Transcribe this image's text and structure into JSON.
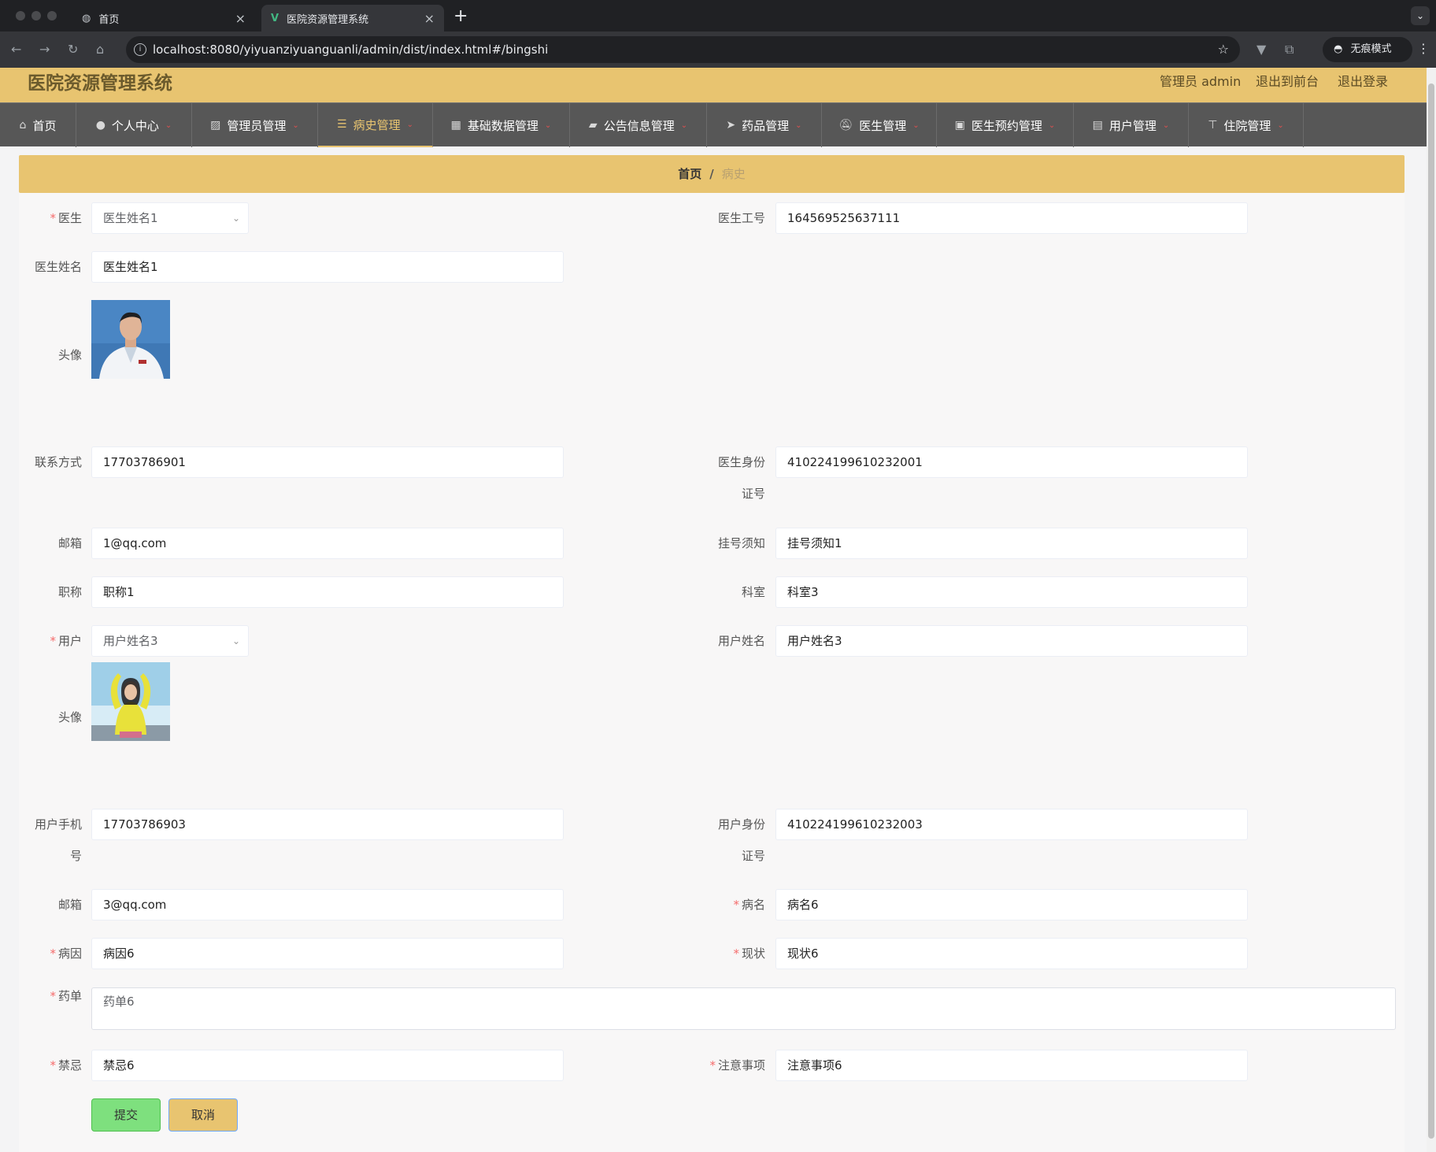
{
  "browser": {
    "tabs": [
      {
        "title": "首页",
        "active": false
      },
      {
        "title": "医院资源管理系统",
        "active": true
      }
    ],
    "url": "localhost:8080/yiyuanziyuanguanli/admin/dist/index.html#/bingshi",
    "incognito_label": "无痕模式"
  },
  "header": {
    "title": "医院资源管理系统",
    "user_label": "管理员 admin",
    "to_front": "退出到前台",
    "logout": "退出登录"
  },
  "nav": [
    {
      "label": "首页",
      "icon": "home-icon",
      "has_dropdown": false
    },
    {
      "label": "个人中心",
      "icon": "user-icon",
      "has_dropdown": true
    },
    {
      "label": "管理员管理",
      "icon": "chart-icon",
      "has_dropdown": true
    },
    {
      "label": "病史管理",
      "icon": "list-icon",
      "has_dropdown": true,
      "active": true
    },
    {
      "label": "基础数据管理",
      "icon": "grid-icon",
      "has_dropdown": true
    },
    {
      "label": "公告信息管理",
      "icon": "ticket-icon",
      "has_dropdown": true
    },
    {
      "label": "药品管理",
      "icon": "send-icon",
      "has_dropdown": true
    },
    {
      "label": "医生管理",
      "icon": "bell-off-icon",
      "has_dropdown": true
    },
    {
      "label": "医生预约管理",
      "icon": "briefcase-icon",
      "has_dropdown": true
    },
    {
      "label": "用户管理",
      "icon": "clipboard-icon",
      "has_dropdown": true
    },
    {
      "label": "住院管理",
      "icon": "stamp-icon",
      "has_dropdown": true
    }
  ],
  "breadcrumb": {
    "home": "首页",
    "separator": "/",
    "current": "病史"
  },
  "form": {
    "doctor": {
      "label": "医生",
      "value": "医生姓名1"
    },
    "doctor_no": {
      "label": "医生工号",
      "value": "164569525637111"
    },
    "doctor_name": {
      "label": "医生姓名",
      "value": "医生姓名1"
    },
    "doctor_avatar": {
      "label": "头像"
    },
    "doctor_phone": {
      "label": "联系方式",
      "value": "17703786901"
    },
    "doctor_idcard": {
      "label_1": "医生身份",
      "label_2": "证号",
      "value": "410224199610232001"
    },
    "doctor_email": {
      "label": "邮箱",
      "value": "1@qq.com"
    },
    "register_notice": {
      "label": "挂号须知",
      "value": "挂号须知1"
    },
    "title": {
      "label": "职称",
      "value": "职称1"
    },
    "department": {
      "label": "科室",
      "value": "科室3"
    },
    "user": {
      "label": "用户",
      "value": "用户姓名3"
    },
    "user_name": {
      "label": "用户姓名",
      "value": "用户姓名3"
    },
    "user_avatar": {
      "label": "头像"
    },
    "user_phone": {
      "label_1": "用户手机",
      "label_2": "号",
      "value": "17703786903"
    },
    "user_idcard": {
      "label_1": "用户身份",
      "label_2": "证号",
      "value": "410224199610232003"
    },
    "user_email": {
      "label": "邮箱",
      "value": "3@qq.com"
    },
    "disease": {
      "label": "病名",
      "value": "病名6"
    },
    "cause": {
      "label": "病因",
      "value": "病因6"
    },
    "status": {
      "label": "现状",
      "value": "现状6"
    },
    "prescription": {
      "label": "药单",
      "value": "药单6"
    },
    "taboo": {
      "label": "禁忌",
      "value": "禁忌6"
    },
    "notes": {
      "label": "注意事项",
      "value": "注意事项6"
    },
    "submit": "提交",
    "cancel": "取消"
  },
  "colors": {
    "accent": "#e8c470",
    "menu_bg": "#575757",
    "required": "#f56c6c",
    "submit": "#7ee07e"
  }
}
